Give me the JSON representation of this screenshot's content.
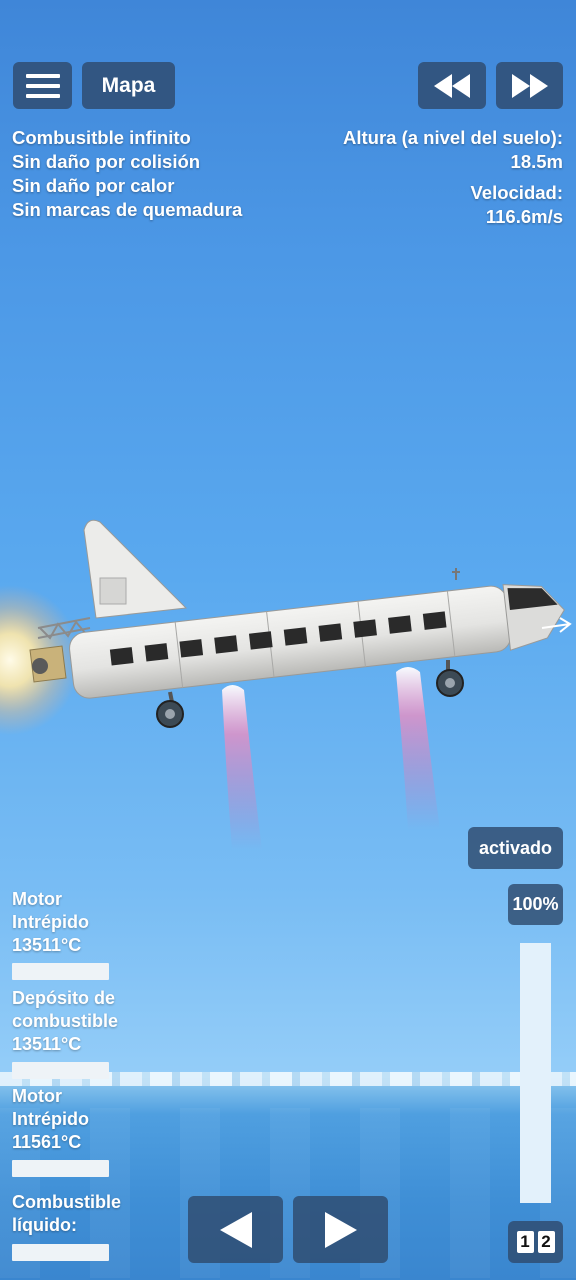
{
  "header": {
    "map_label": "Mapa"
  },
  "cheats": {
    "items": [
      "Combusitble infinito",
      "Sin daño por colisión",
      "Sin daño por calor",
      "Sin marcas de quemadura"
    ]
  },
  "stats": {
    "altitude_label": "Altura (a nivel del suelo):",
    "altitude_value": "18.5m",
    "velocity_label": "Velocidad:",
    "velocity_value": "116.6m/s"
  },
  "controls": {
    "activated_label": "activado",
    "throttle_label": "100%",
    "throttle_level": 1.0,
    "stage_a": "1",
    "stage_b": "2"
  },
  "parts": [
    {
      "name_line1": "Motor",
      "name_line2": "Intrépido",
      "temp": "13511°C"
    },
    {
      "name_line1": "Depósito de",
      "name_line2": "combustible",
      "temp": "13511°C"
    },
    {
      "name_line1": "Motor",
      "name_line2": "Intrépido",
      "temp": "11561°C"
    },
    {
      "name_line1": "Combustible",
      "name_line2": "líquido:",
      "temp": ""
    }
  ],
  "icons": {
    "menu": "hamburger-menu-icon",
    "rewind": "rewind-icon",
    "fast_forward": "fast-forward-icon",
    "left": "arrow-left-icon",
    "right": "arrow-right-icon"
  }
}
